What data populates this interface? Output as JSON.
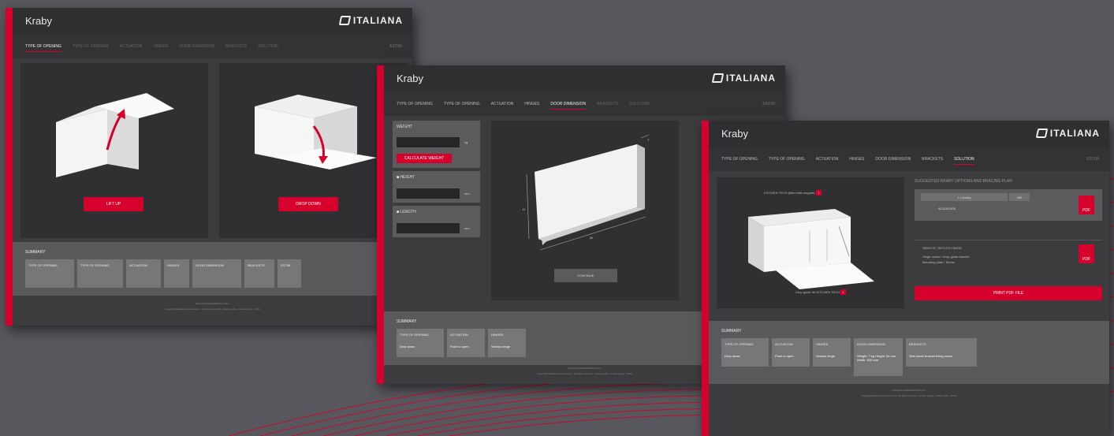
{
  "window1": {
    "brand": "Kraby",
    "logo": "ITALIANA",
    "nav": [
      "TYPE OF OPENING",
      "TYPE OF OPENING",
      "ACTUATION",
      "HINGES",
      "DOOR DIMENSION",
      "BRACKETS",
      "SOLUTION"
    ],
    "nav_right": "ESTIM.",
    "lift_up": "LIFT UP",
    "drop_down": "DROP DOWN",
    "summary_title": "SUMMARY",
    "chips": [
      "TYPE OF OPENING",
      "TYPE OF OPENING",
      "ACTUATION",
      "HINGES",
      "DOOR DIMENSION",
      "BRACKETS",
      "ESTIM."
    ],
    "footer_line1": "ITALIANA FERRAMENTA S.R.L.",
    "footer_line2": "Copyright Italiana Ferramenta srl - all rights reserved - privacy policy - cookie policy - P.IVA"
  },
  "window2": {
    "brand": "Kraby",
    "logo": "ITALIANA",
    "nav": [
      "TYPE OF OPENING",
      "TYPE OF OPENING",
      "ACTUATION",
      "HINGES",
      "DOOR DIMENSION",
      "BRACKETS",
      "SOLUTION"
    ],
    "nav_right": "ESTIM.",
    "weight_label": "WEIGHT",
    "weight_unit": "kg",
    "calc_weight": "CALCULATE WEIGHT",
    "height_label": "HEIGHT",
    "height_unit": "mm",
    "length_label": "LENGTH",
    "length_unit": "mm",
    "dim_w": "W",
    "dim_h": "H",
    "dim_t": "T",
    "continue": "CONTINUE",
    "summary_title": "SUMMARY",
    "chips": [
      {
        "label": "TYPE OF OPENING",
        "value": "Drop down"
      },
      {
        "label": "ACTUATION",
        "value": "Push to open"
      },
      {
        "label": "HINGES",
        "value": "Sensys hinge"
      }
    ],
    "footer_line1": "ITALIANA FERRAMENTA S.R.L.",
    "footer_line2": "Copyright Italiana Ferramenta srl - all rights reserved - privacy policy - cookie policy - P.IVA"
  },
  "window3": {
    "brand": "Kraby",
    "logo": "ITALIANA",
    "nav": [
      "TYPE OF OPENING",
      "TYPE OF OPENING",
      "ACTUATION",
      "HINGES",
      "DOOR DIMENSION",
      "BRACKETS",
      "SOLUTION"
    ],
    "nav_right": "ESTIM.",
    "note_top": "KITCHEN TECH (fitted with magnet)",
    "note_bottom": "Drop guide for KITCHEN TECH",
    "options_title": "SUGGESTED KRABY OPTIONS AND BRACING PLAN",
    "opt_a": "1 x Kraby",
    "opt_b": "180",
    "opt_code": "ACD001205",
    "info_title": "SENSYS / SKYLITE HINGE",
    "info_line1": "Hinge model / Drop guide bracket",
    "info_line2": "Mounting plate / Screw",
    "print": "PRINT PDF FILE",
    "summary_title": "SUMMARY",
    "chips": [
      {
        "label": "TYPE OF OPENING",
        "value": "Drop down"
      },
      {
        "label": "ACTUATION",
        "value": "Push to open"
      },
      {
        "label": "HINGES",
        "value": "Sensys hinge"
      },
      {
        "label": "DOOR DIMENSION",
        "value": "Weight: 7 kg  Height: 3x mm  Width: 600 mm"
      },
      {
        "label": "BRACKETS",
        "value": "Side panel bracket fixing screw"
      }
    ],
    "footer_line1": "ITALIANA FERRAMENTA S.R.L.",
    "footer_line2": "Copyright Italiana Ferramenta srl - all rights reserved - privacy policy - cookie policy - P.IVA"
  },
  "colors": {
    "accent": "#d5002b",
    "background": "#58575d",
    "window": "#3c3c3e"
  }
}
